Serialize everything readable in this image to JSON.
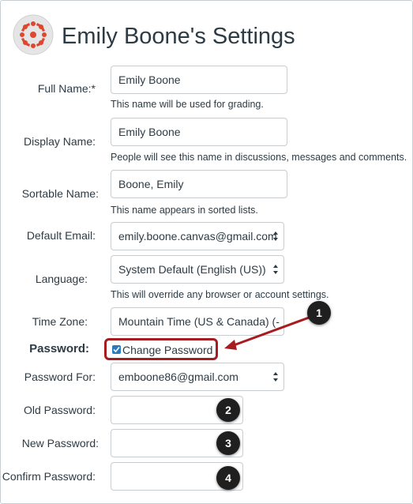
{
  "page": {
    "title": "Emily Boone's Settings"
  },
  "form": {
    "full_name": {
      "label": "Full Name:*",
      "value": "Emily Boone",
      "hint": "This name will be used for grading."
    },
    "display_name": {
      "label": "Display Name:",
      "value": "Emily Boone",
      "hint": "People will see this name in discussions, messages and comments."
    },
    "sortable_name": {
      "label": "Sortable Name:",
      "value": "Boone, Emily",
      "hint": "This name appears in sorted lists."
    },
    "default_email": {
      "label": "Default Email:",
      "value": "emily.boone.canvas@gmail.com"
    },
    "language": {
      "label": "Language:",
      "value": "System Default (English (US))",
      "hint": "This will override any browser or account settings."
    },
    "time_zone": {
      "label": "Time Zone:",
      "value": "Mountain Time (US & Canada) (-"
    },
    "password": {
      "label": "Password:",
      "change_checkbox_label": "Change Password",
      "change_checked": true
    },
    "password_for": {
      "label": "Password For:",
      "value": "emboone86@gmail.com"
    },
    "old_password": {
      "label": "Old Password:",
      "value": ""
    },
    "new_password": {
      "label": "New Password:",
      "value": ""
    },
    "confirm_password": {
      "label": "Confirm Password:",
      "value": ""
    }
  },
  "callouts": [
    "1",
    "2",
    "3",
    "4"
  ],
  "colors": {
    "brand": "#e0462f",
    "highlight": "#a61c20",
    "checkbox": "#2b7abc",
    "badge": "#1f1f1f"
  },
  "icons": {
    "logo": "canvas-logo-icon",
    "select_caret": "updown-caret-icon",
    "check": "check-icon"
  }
}
